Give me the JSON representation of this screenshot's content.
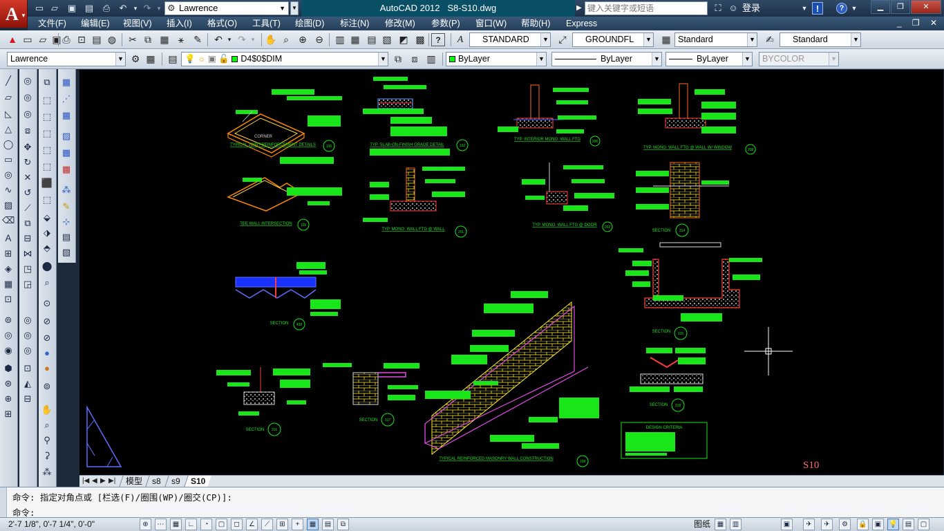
{
  "titlebar": {
    "app_menu_letter": "A",
    "workspace": "Lawrence",
    "app_name": "AutoCAD 2012",
    "document": "S8-S10.dwg",
    "search_placeholder": "键入关键字或短语",
    "login": "登录",
    "window_controls": [
      "▁",
      "❐",
      "✕"
    ]
  },
  "menu": {
    "items": [
      "文件(F)",
      "编辑(E)",
      "视图(V)",
      "插入(I)",
      "格式(O)",
      "工具(T)",
      "绘图(D)",
      "标注(N)",
      "修改(M)",
      "参数(P)",
      "窗口(W)",
      "帮助(H)",
      "Express"
    ],
    "doc_controls": "_ ❐ ✕"
  },
  "styles": {
    "text_style": "STANDARD",
    "dim_style": "GROUNDFL",
    "table_style": "Standard",
    "multileader_style": "Standard"
  },
  "layers": {
    "workspace_combo": "Lawrence",
    "current_layer": "D4$0$DIM",
    "color": "ByLayer",
    "linetype": "ByLayer",
    "lineweight": "ByLayer",
    "plotstyle": "BYCOLOR"
  },
  "drawing": {
    "sheet_label": "S10",
    "details": [
      {
        "title": "CORNER",
        "subtitle": "TYPICAL JOINT REINFORCEMENT DETAILS",
        "num": "106"
      },
      {
        "title": "TYP. SLAB-ON-FINISH GRADE DETAIL",
        "num": "132"
      },
      {
        "title": "TYP. INTERIOR MONO. WALL FTG",
        "num": "206"
      },
      {
        "title": "TYP. MONO. WALL FTG @ WALL W/ WINDOW",
        "num": "208"
      },
      {
        "title": "TEE WALL INTERSECTION",
        "num": "105"
      },
      {
        "title": "TYP. MONO. WALL FTG @ WALL",
        "num": "201"
      },
      {
        "title": "TYP. MONO. WALL FTG @ DOOR",
        "num": "202"
      },
      {
        "title": "SECTION",
        "num": "314"
      },
      {
        "title": "SECTION",
        "num": "438"
      },
      {
        "title": "SECTION",
        "num": "315"
      },
      {
        "title": "SECTION",
        "num": "316"
      },
      {
        "title": "SECTION",
        "num": "317"
      },
      {
        "title": "SECTION",
        "num": "318"
      },
      {
        "title": "TYPICAL REINFORCED MASONRY WALL CONSTRUCTION",
        "num": "108"
      }
    ],
    "design_criteria_title": "DESIGN CRITERIA"
  },
  "tabs": {
    "items": [
      "模型",
      "s8",
      "s9",
      "S10"
    ],
    "active": "S10"
  },
  "command": {
    "history": "命令: 指定对角点或 [栏选(F)/圈围(WP)/圈交(CP)]:",
    "prompt": "命令:"
  },
  "status": {
    "coords": "2'-7 1/8\", 0'-7 1/4\", 0'-0\"",
    "paper_label": "图纸"
  }
}
